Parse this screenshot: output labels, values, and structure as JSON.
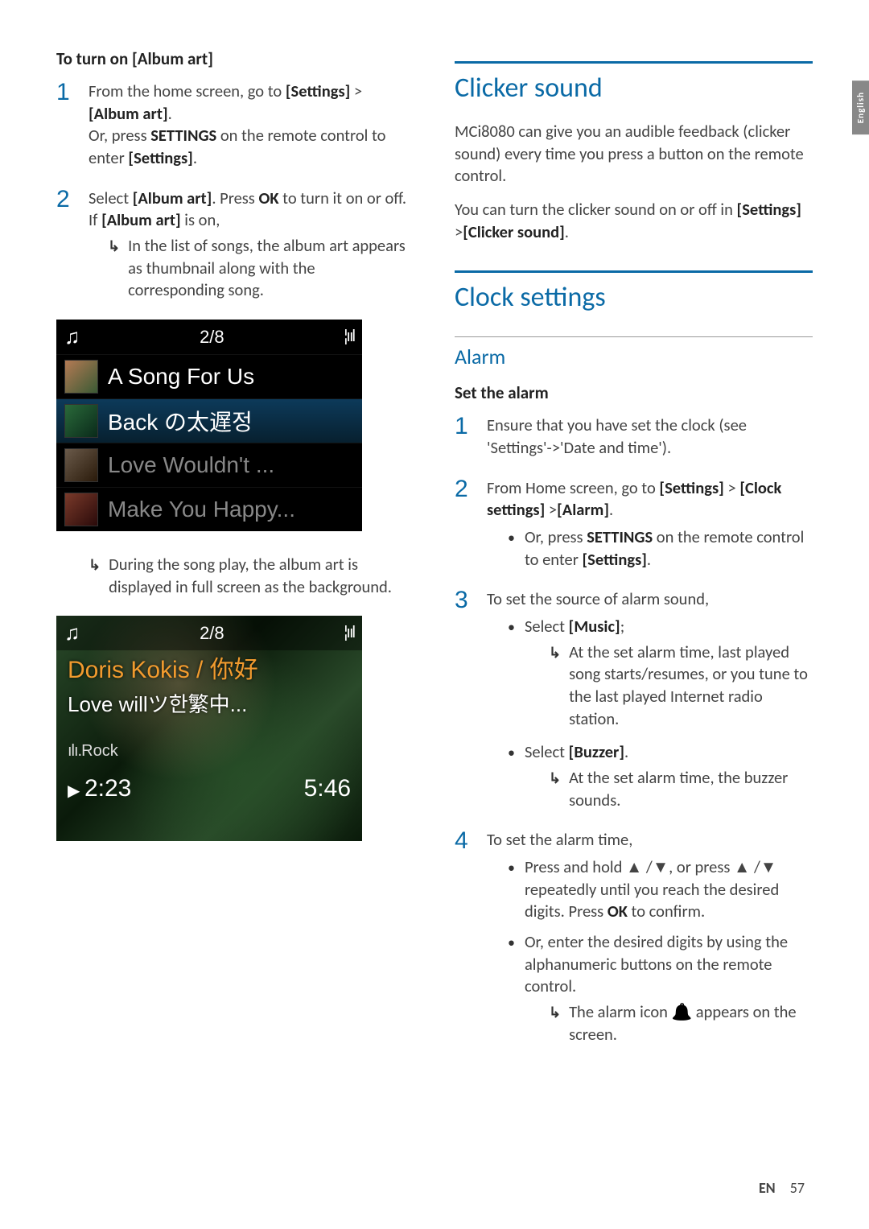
{
  "sidetab": "English",
  "left": {
    "subhead": "To turn on [Album art]",
    "steps": [
      {
        "num": "1",
        "text_a": "From the home screen, go to ",
        "bold_a": "[Settings]",
        "text_b": " > ",
        "bold_b": "[Album art]",
        "text_c": ".",
        "line2_a": "Or, press ",
        "line2_bold": "SETTINGS",
        "line2_b": " on the remote control to enter ",
        "line2_bold2": "[Settings]",
        "line2_c": "."
      },
      {
        "num": "2",
        "text_a": "Select ",
        "bold_a": "[Album art]",
        "text_b": ". Press ",
        "bold_b": "OK",
        "text_c": " to turn it on or off.",
        "line_if_a": "If ",
        "line_if_bold": "[Album art]",
        "line_if_b": " is on,",
        "result": "In the list of songs, the album art appears as thumbnail along with the corresponding song."
      }
    ],
    "screen1": {
      "counter": "2/8",
      "rows": [
        {
          "label": "A Song For Us"
        },
        {
          "label": "Back の太遅정"
        },
        {
          "label": "Love Wouldn't ..."
        },
        {
          "label": "Make You Happy..."
        }
      ]
    },
    "result2": "During the song play, the album art is displayed in full screen as the background.",
    "screen2": {
      "counter": "2/8",
      "artist": "Doris Kokis / 你好",
      "track": "Love willツ한繁中...",
      "genre": "Rock",
      "elapsed": "2:23",
      "total": "5:46"
    }
  },
  "right": {
    "sec1_title": "Clicker sound",
    "sec1_p1": "MCi8080 can give you an audible feedback (clicker sound) every time you press a button on the remote control.",
    "sec1_p2_a": "You can turn the clicker sound on or off in ",
    "sec1_p2_b1": "[Settings]",
    "sec1_p2_mid": " >",
    "sec1_p2_b2": "[Clicker sound]",
    "sec1_p2_end": ".",
    "sec2_title": "Clock settings",
    "alarm_title": "Alarm",
    "alarm_sub": "Set the alarm",
    "alarm_steps": {
      "s1": {
        "num": "1",
        "a": "Ensure that you have set the clock (see 'Settings'->'Date and time')."
      },
      "s2": {
        "num": "2",
        "a": "From Home screen, go to ",
        "b1": "[Settings]",
        "mid1": " > ",
        "b2": "[Clock settings]",
        "mid2": " >",
        "b3": "[Alarm]",
        "end": ".",
        "bullet_a": "Or, press ",
        "bullet_bold": "SETTINGS",
        "bullet_b": " on the remote control to enter ",
        "bullet_bold2": "[Settings]",
        "bullet_end": "."
      },
      "s3": {
        "num": "3",
        "lead": "To set the source of alarm sound,",
        "opt1_a": "Select ",
        "opt1_b": "[Music]",
        "opt1_end": ";",
        "opt1_res": "At the set alarm time, last played song starts/resumes, or you tune to the last played Internet radio station.",
        "opt2_a": "Select ",
        "opt2_b": "[Buzzer]",
        "opt2_end": ".",
        "opt2_res": "At the set alarm time, the buzzer sounds."
      },
      "s4": {
        "num": "4",
        "lead": "To set the alarm time,",
        "b1_a": "Press and hold ",
        "b1_mid1": " /",
        "b1_mid2": ", or press ",
        "b1_mid3": " /",
        "b1_b": " repeatedly until you reach the desired digits. Press ",
        "b1_ok": "OK",
        "b1_end": " to confirm.",
        "b2": "Or, enter the desired digits by using the alphanumeric buttons on the remote control.",
        "b2_res_a": "The alarm icon ",
        "b2_res_b": " appears on the screen."
      }
    }
  },
  "footer": {
    "lang": "EN",
    "page": "57"
  }
}
